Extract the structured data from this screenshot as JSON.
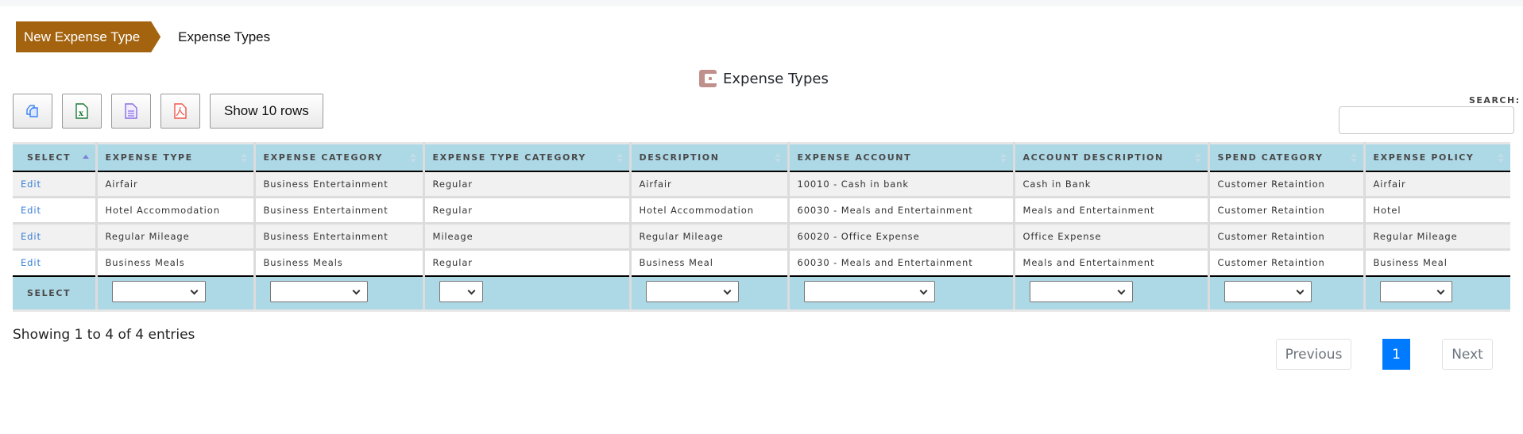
{
  "breadcrumb": {
    "active_label": "New Expense Type",
    "current_label": "Expense Types"
  },
  "caption": {
    "icon": "wallet-icon",
    "title": "Expense Types"
  },
  "toolbar": {
    "buttons": [
      {
        "name": "copy-button",
        "icon": "copy-icon",
        "color": "#3b82f6"
      },
      {
        "name": "excel-button",
        "icon": "excel-icon",
        "color": "#1d7a3a"
      },
      {
        "name": "csv-button",
        "icon": "document-icon",
        "color": "#8b6fe0"
      },
      {
        "name": "pdf-button",
        "icon": "pdf-icon",
        "color": "#f0564a"
      }
    ],
    "show_rows_label": "Show 10 rows"
  },
  "search": {
    "label": "SEARCH:",
    "value": "",
    "placeholder": ""
  },
  "table": {
    "columns": [
      {
        "label": "SELECT",
        "sort": "asc"
      },
      {
        "label": "EXPENSE TYPE",
        "sort": "both"
      },
      {
        "label": "EXPENSE CATEGORY",
        "sort": "both"
      },
      {
        "label": "EXPENSE TYPE CATEGORY",
        "sort": "both"
      },
      {
        "label": "DESCRIPTION",
        "sort": "both"
      },
      {
        "label": "EXPENSE ACCOUNT",
        "sort": "both"
      },
      {
        "label": "ACCOUNT DESCRIPTION",
        "sort": "both"
      },
      {
        "label": "SPEND CATEGORY",
        "sort": "both"
      },
      {
        "label": "EXPENSE POLICY",
        "sort": "both"
      }
    ],
    "rows": [
      {
        "action": "Edit",
        "cells": [
          "Airfair",
          "Business Entertainment",
          "Regular",
          "Airfair",
          "10010 - Cash in bank",
          "Cash in Bank",
          "Customer Retaintion",
          "Airfair"
        ]
      },
      {
        "action": "Edit",
        "cells": [
          "Hotel Accommodation",
          "Business Entertainment",
          "Regular",
          "Hotel Accommodation",
          "60030 - Meals and Entertainment",
          "Meals and Entertainment",
          "Customer Retaintion",
          "Hotel"
        ]
      },
      {
        "action": "Edit",
        "cells": [
          "Regular Mileage",
          "Business Entertainment",
          "Mileage",
          "Regular Mileage",
          "60020 - Office Expense",
          "Office Expense",
          "Customer Retaintion",
          "Regular Mileage"
        ]
      },
      {
        "action": "Edit",
        "cells": [
          "Business Meals",
          "Business Meals",
          "Regular",
          "Business Meal",
          "60030 - Meals and Entertainment",
          "Meals and Entertainment",
          "Customer Retaintion",
          "Business Meal"
        ]
      }
    ],
    "footer_label": "SELECT",
    "footer_filters": [
      "",
      "",
      "",
      "",
      "",
      "",
      "",
      ""
    ]
  },
  "info": "Showing 1 to 4 of 4 entries",
  "pagination": {
    "previous": "Previous",
    "pages": [
      "1"
    ],
    "current": "1",
    "next": "Next"
  },
  "colors": {
    "breadcrumb_active": "#a4640f",
    "header_bg": "#add8e6",
    "link": "#3a7fd5",
    "page_current": "#007bff"
  }
}
